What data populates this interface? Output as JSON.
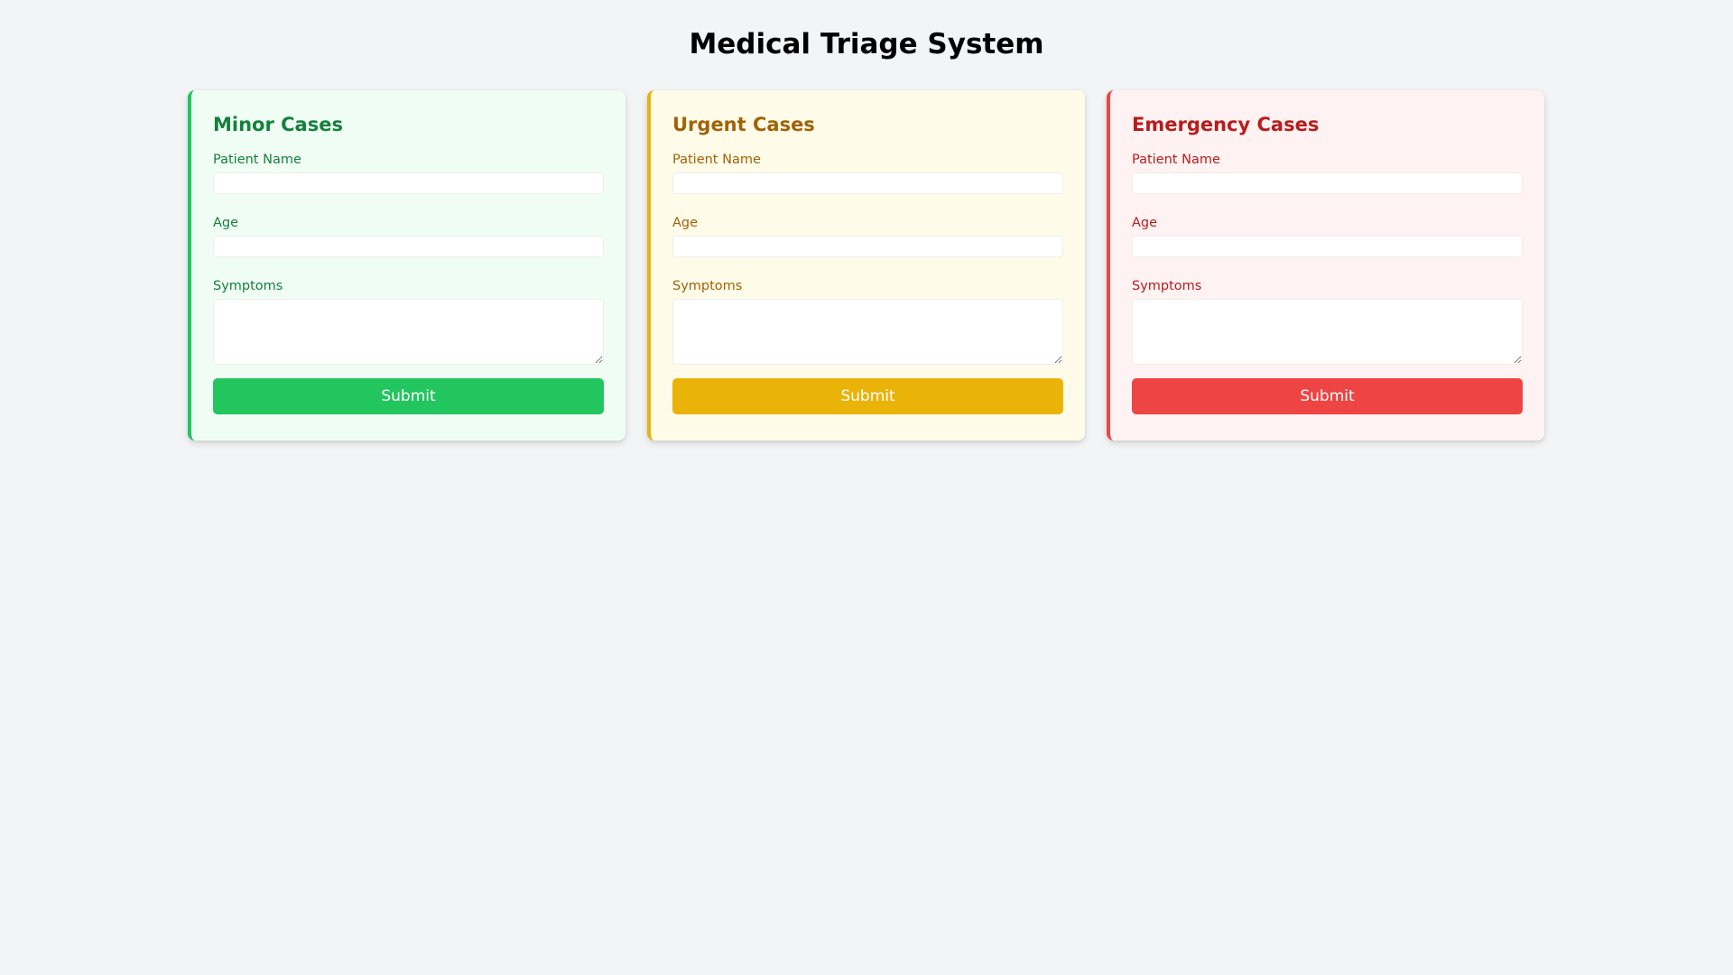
{
  "page": {
    "title": "Medical Triage System"
  },
  "cards": [
    {
      "title": "Minor Cases",
      "name_label": "Patient Name",
      "name_value": "",
      "age_label": "Age",
      "age_value": "",
      "symptoms_label": "Symptoms",
      "symptoms_value": "",
      "submit_label": "Submit",
      "accent_color": "#22c55e",
      "text_color": "#15803d",
      "background_color": "#f0fdf4"
    },
    {
      "title": "Urgent Cases",
      "name_label": "Patient Name",
      "name_value": "",
      "age_label": "Age",
      "age_value": "",
      "symptoms_label": "Symptoms",
      "symptoms_value": "",
      "submit_label": "Submit",
      "accent_color": "#eab308",
      "text_color": "#a16207",
      "background_color": "#fefce8"
    },
    {
      "title": "Emergency Cases",
      "name_label": "Patient Name",
      "name_value": "",
      "age_label": "Age",
      "age_value": "",
      "symptoms_label": "Symptoms",
      "symptoms_value": "",
      "submit_label": "Submit",
      "accent_color": "#ef4444",
      "text_color": "#b91c1c",
      "background_color": "#fef2f2"
    }
  ]
}
